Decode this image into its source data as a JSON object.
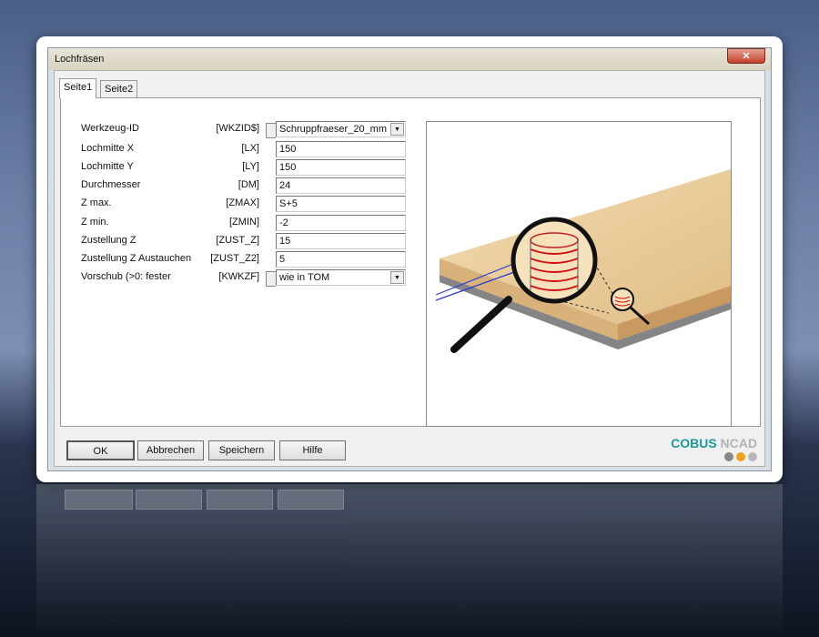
{
  "window": {
    "title": "Lochfräsen",
    "close_icon": "close-icon"
  },
  "tabs": [
    {
      "label": "Seite1",
      "active": true
    },
    {
      "label": "Seite2",
      "active": false
    }
  ],
  "fields": [
    {
      "label": "Werkzeug-ID",
      "code": "[WKZID$]",
      "value": "Schruppfraeser_20_mm",
      "type": "combo"
    },
    {
      "label": "Lochmitte X",
      "code": "[LX]",
      "value": "150"
    },
    {
      "label": "Lochmitte Y",
      "code": "[LY]",
      "value": "150"
    },
    {
      "label": "Durchmesser",
      "code": "[DM]",
      "value": "24"
    },
    {
      "label": "Z max.",
      "code": "[ZMAX]",
      "value": "S+5"
    },
    {
      "label": "Z min.",
      "code": "[ZMIN]",
      "value": "-2"
    },
    {
      "label": "Zustellung Z",
      "code": "[ZUST_Z]",
      "value": "15"
    },
    {
      "label": "Zustellung Z Austauchen",
      "code": "[ZUST_Z2]",
      "value": "5"
    },
    {
      "label": "Vorschub (>0: fester",
      "code": "[KWKZF]",
      "value": "wie in TOM",
      "type": "combo"
    }
  ],
  "buttons": {
    "ok": "OK",
    "cancel": "Abbrechen",
    "save": "Speichern",
    "help": "Hilfe"
  },
  "logo": {
    "part1": "COBUS",
    "part2": "NCAD",
    "colors": [
      "#1a9a98",
      "#b0b4b8",
      "#888888",
      "#f0a020",
      "#b8b8b8"
    ]
  }
}
